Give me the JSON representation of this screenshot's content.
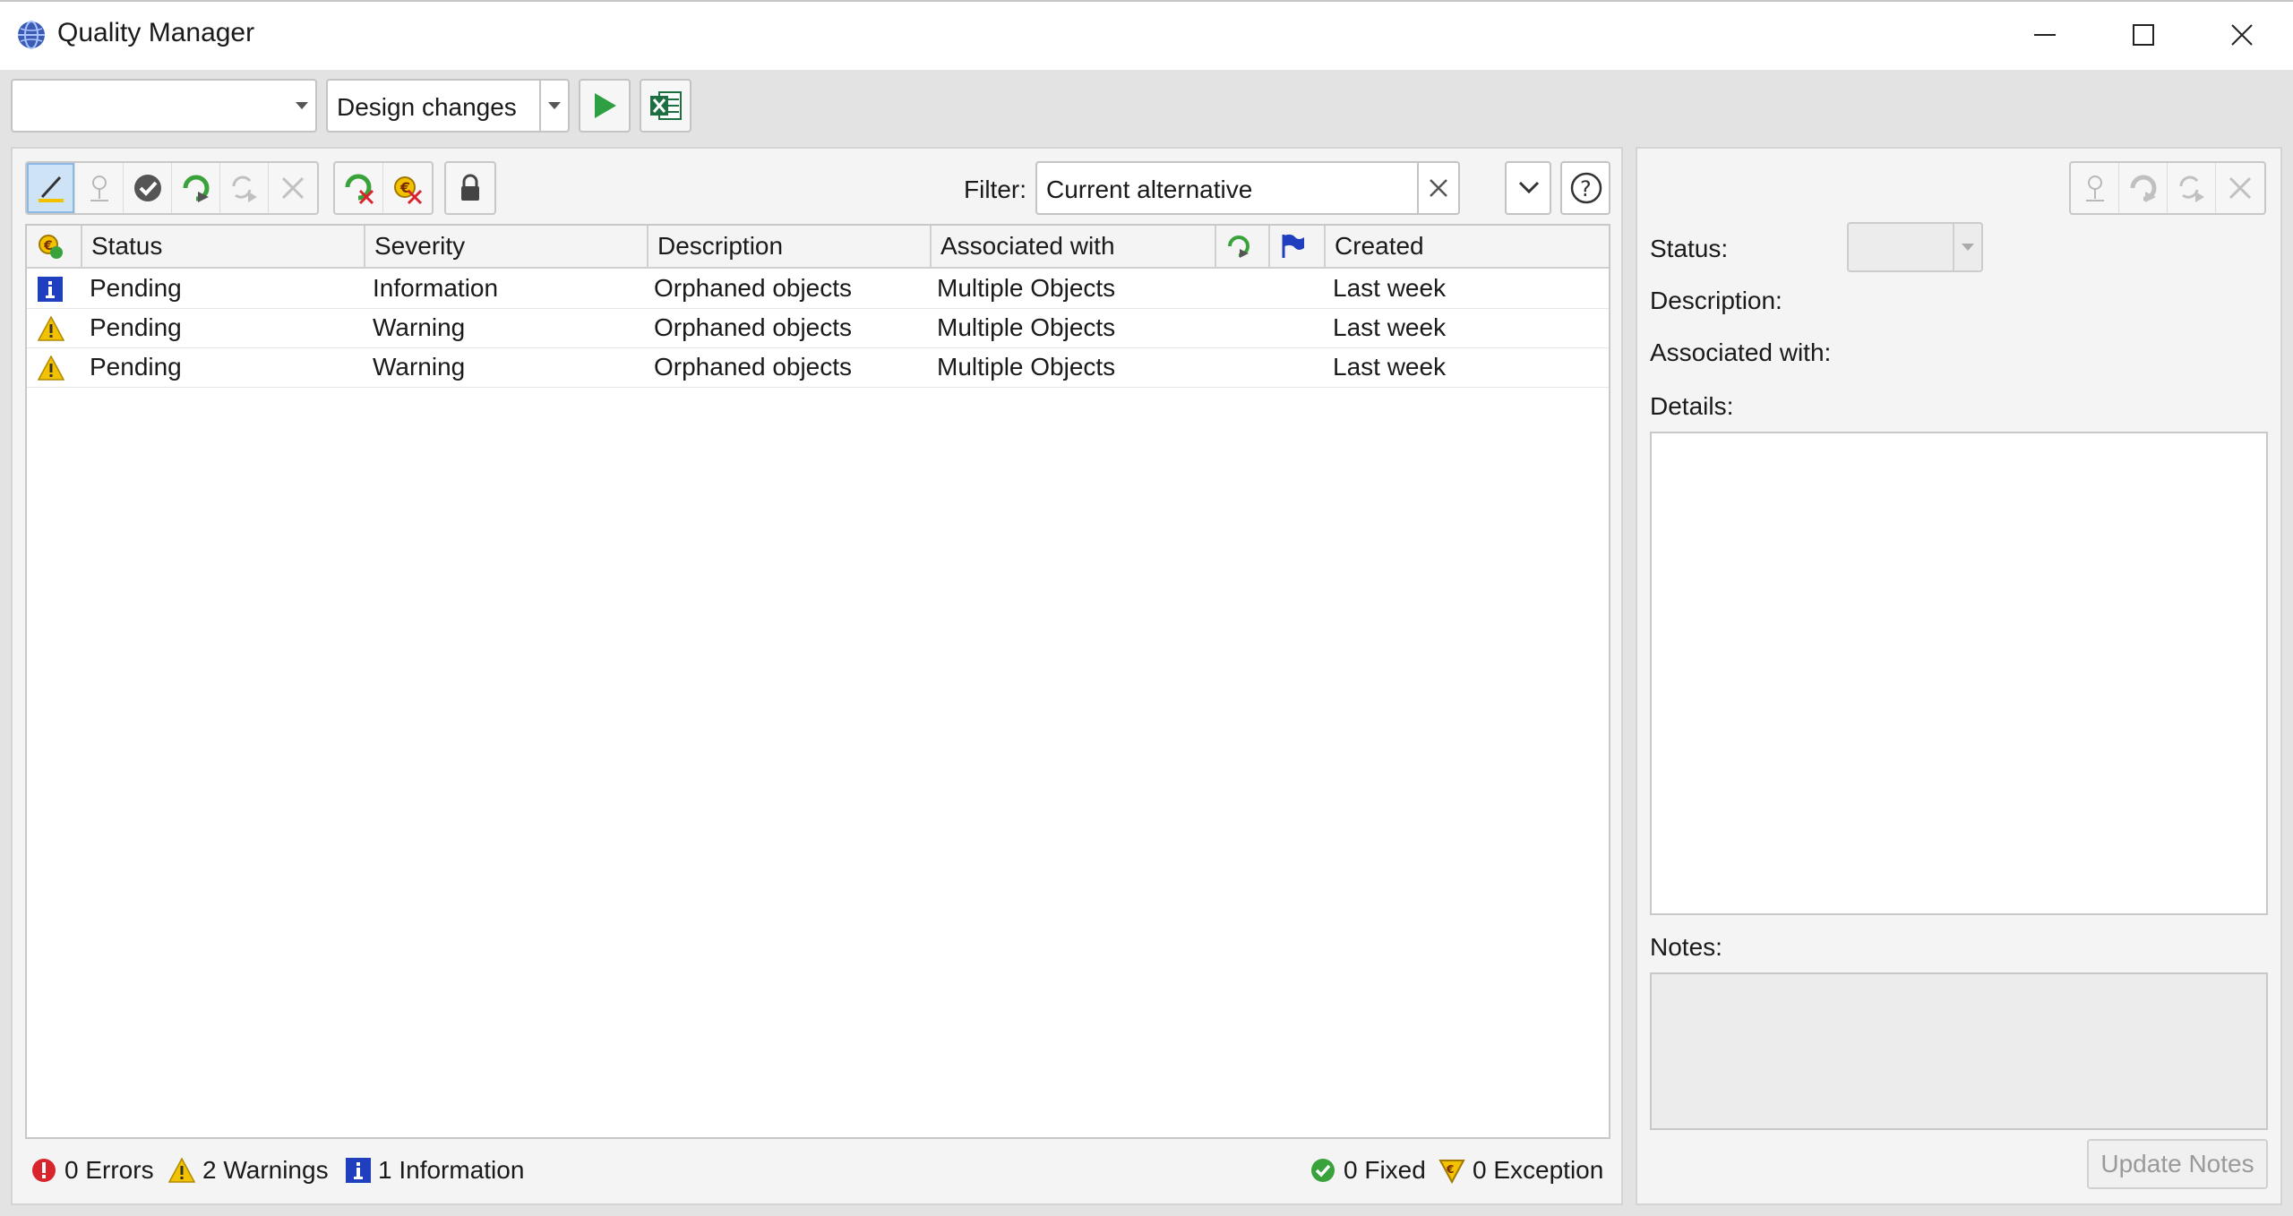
{
  "window": {
    "title": "Quality Manager"
  },
  "toolbar": {
    "scope_combo_value": "",
    "mode_combo_value": "Design changes"
  },
  "filter": {
    "label": "Filter:",
    "value": "Current alternative"
  },
  "grid": {
    "columns": [
      "Status",
      "Severity",
      "Description",
      "Associated with",
      "Created"
    ],
    "rows": [
      {
        "icon": "info-icon",
        "status": "Pending",
        "severity": "Information",
        "description": "Orphaned objects",
        "associated_with": "Multiple Objects",
        "created": "Last week"
      },
      {
        "icon": "warning-icon",
        "status": "Pending",
        "severity": "Warning",
        "description": "Orphaned objects",
        "associated_with": "Multiple Objects",
        "created": "Last week"
      },
      {
        "icon": "warning-icon",
        "status": "Pending",
        "severity": "Warning",
        "description": "Orphaned objects",
        "associated_with": "Multiple Objects",
        "created": "Last week"
      }
    ]
  },
  "statusbar": {
    "errors": "0 Errors",
    "warnings": "2 Warnings",
    "information": "1 Information",
    "fixed": "0 Fixed",
    "exception": "0 Exception"
  },
  "details": {
    "status_label": "Status:",
    "status_value": "",
    "description_label": "Description:",
    "associated_label": "Associated with:",
    "details_label": "Details:",
    "notes_label": "Notes:",
    "update_notes_label": "Update Notes"
  },
  "colors": {
    "info_blue": "#1f3fbf",
    "warning_yellow": "#f2c200",
    "error_red": "#d9232d",
    "ok_green": "#3aa23a",
    "play_green": "#2ea043",
    "excel_green": "#1d6f42"
  }
}
